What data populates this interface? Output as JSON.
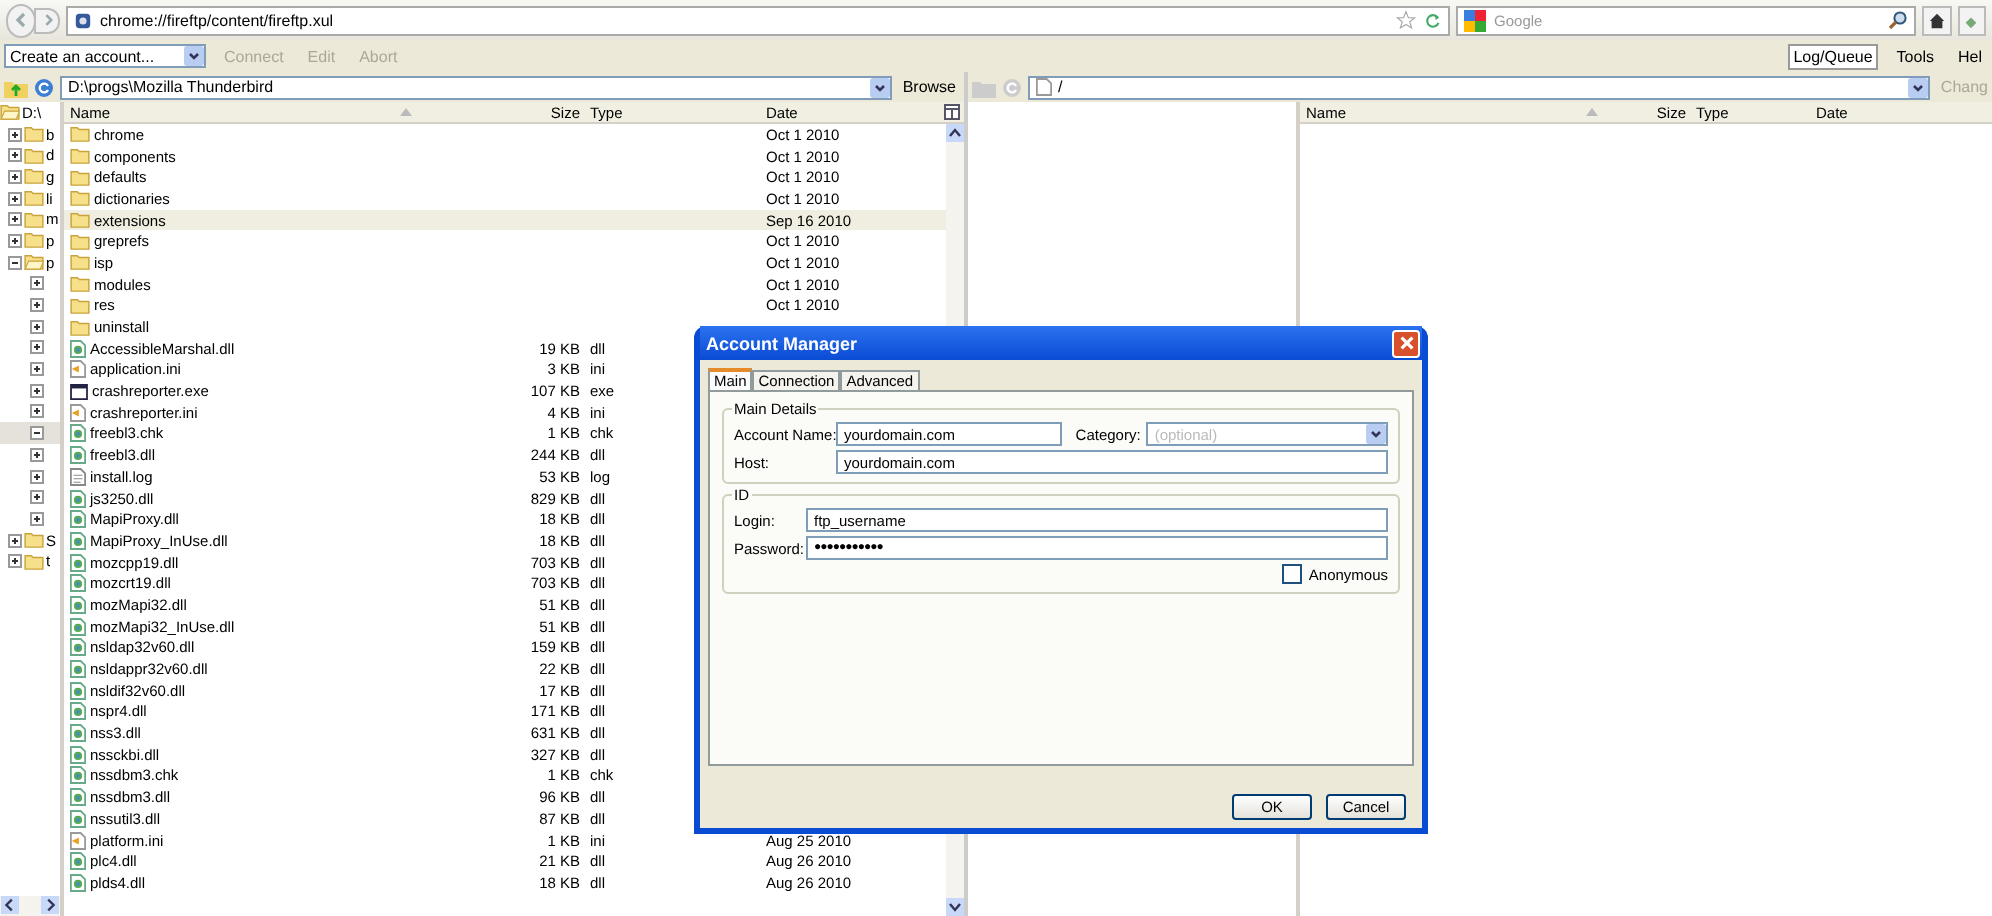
{
  "browser": {
    "address": "chrome://fireftp/content/fireftp.xul",
    "search": {
      "placeholder": "Google"
    }
  },
  "toolbar": {
    "account_select": "Create an account...",
    "actions": [
      {
        "label": "Connect",
        "disabled": true
      },
      {
        "label": "Edit",
        "disabled": true
      },
      {
        "label": "Abort",
        "disabled": true
      }
    ],
    "menu": [
      {
        "label": "Log/Queue",
        "selected": true
      },
      {
        "label": "Tools",
        "selected": false
      },
      {
        "label": "Hel",
        "selected": false
      }
    ]
  },
  "local": {
    "path": "D:\\progs\\Mozilla Thunderbird",
    "browse": "Browse",
    "tree": [
      {
        "label": "D:\\",
        "expanded": true,
        "selected": false,
        "children": [
          {
            "label": "b",
            "expanded": false,
            "selected": false
          },
          {
            "label": "d",
            "expanded": false,
            "selected": false
          },
          {
            "label": "g",
            "expanded": false,
            "selected": false
          },
          {
            "label": "li",
            "expanded": false,
            "selected": false
          },
          {
            "label": "m",
            "expanded": false,
            "selected": false
          },
          {
            "label": "p",
            "expanded": false,
            "selected": false
          },
          {
            "label": "p",
            "expanded": true,
            "selected": false,
            "children": [
              {
                "expanded": false,
                "selected": false
              },
              {
                "expanded": false,
                "selected": false
              },
              {
                "expanded": false,
                "selected": false
              },
              {
                "expanded": false,
                "selected": false
              },
              {
                "expanded": false,
                "selected": false
              },
              {
                "expanded": false,
                "selected": false
              },
              {
                "expanded": false,
                "selected": false
              },
              {
                "expanded": true,
                "selected": true
              },
              {
                "expanded": false,
                "selected": false
              },
              {
                "expanded": false,
                "selected": false
              },
              {
                "expanded": false,
                "selected": false
              },
              {
                "expanded": false,
                "selected": false
              }
            ]
          },
          {
            "label": "S",
            "expanded": false,
            "selected": false
          },
          {
            "label": "t",
            "expanded": false,
            "selected": false
          }
        ]
      }
    ],
    "columns": [
      "Name",
      "Size",
      "Type",
      "Date"
    ],
    "rows": [
      {
        "kind": "folder",
        "name": "chrome",
        "date": "Oct 1 2010",
        "selected": false
      },
      {
        "kind": "folder",
        "name": "components",
        "date": "Oct 1 2010",
        "selected": false
      },
      {
        "kind": "folder",
        "name": "defaults",
        "date": "Oct 1 2010",
        "selected": false
      },
      {
        "kind": "folder",
        "name": "dictionaries",
        "date": "Oct 1 2010",
        "selected": false
      },
      {
        "kind": "folder",
        "name": "extensions",
        "date": "Sep 16 2010",
        "selected": true
      },
      {
        "kind": "folder",
        "name": "greprefs",
        "date": "Oct 1 2010",
        "selected": false
      },
      {
        "kind": "folder",
        "name": "isp",
        "date": "Oct 1 2010",
        "selected": false
      },
      {
        "kind": "folder",
        "name": "modules",
        "date": "Oct 1 2010",
        "selected": false
      },
      {
        "kind": "folder",
        "name": "res",
        "date": "Oct 1 2010",
        "selected": false
      },
      {
        "kind": "folder",
        "name": "uninstall",
        "selected": false
      },
      {
        "kind": "library",
        "name": "AccessibleMarshal.dll",
        "size": "19 KB",
        "type": "dll",
        "selected": false
      },
      {
        "kind": "settings",
        "name": "application.ini",
        "size": "3 KB",
        "type": "ini",
        "selected": false
      },
      {
        "kind": "program",
        "name": "crashreporter.exe",
        "size": "107 KB",
        "type": "exe",
        "selected": false
      },
      {
        "kind": "settings",
        "name": "crashreporter.ini",
        "size": "4 KB",
        "type": "ini",
        "selected": false
      },
      {
        "kind": "library",
        "name": "freebl3.chk",
        "size": "1 KB",
        "type": "chk",
        "selected": false
      },
      {
        "kind": "library",
        "name": "freebl3.dll",
        "size": "244 KB",
        "type": "dll",
        "selected": false
      },
      {
        "kind": "text",
        "name": "install.log",
        "size": "53 KB",
        "type": "log",
        "selected": false
      },
      {
        "kind": "library",
        "name": "js3250.dll",
        "size": "829 KB",
        "type": "dll",
        "selected": false
      },
      {
        "kind": "library",
        "name": "MapiProxy.dll",
        "size": "18 KB",
        "type": "dll",
        "selected": false
      },
      {
        "kind": "library",
        "name": "MapiProxy_InUse.dll",
        "size": "18 KB",
        "type": "dll",
        "selected": false
      },
      {
        "kind": "library",
        "name": "mozcpp19.dll",
        "size": "703 KB",
        "type": "dll",
        "selected": false
      },
      {
        "kind": "library",
        "name": "mozcrt19.dll",
        "size": "703 KB",
        "type": "dll",
        "selected": false
      },
      {
        "kind": "library",
        "name": "mozMapi32.dll",
        "size": "51 KB",
        "type": "dll",
        "selected": false
      },
      {
        "kind": "library",
        "name": "mozMapi32_InUse.dll",
        "size": "51 KB",
        "type": "dll",
        "selected": false
      },
      {
        "kind": "library",
        "name": "nsldap32v60.dll",
        "size": "159 KB",
        "type": "dll",
        "selected": false
      },
      {
        "kind": "library",
        "name": "nsldappr32v60.dll",
        "size": "22 KB",
        "type": "dll",
        "selected": false
      },
      {
        "kind": "library",
        "name": "nsldif32v60.dll",
        "size": "17 KB",
        "type": "dll",
        "selected": false
      },
      {
        "kind": "library",
        "name": "nspr4.dll",
        "size": "171 KB",
        "type": "dll",
        "selected": false
      },
      {
        "kind": "library",
        "name": "nss3.dll",
        "size": "631 KB",
        "type": "dll",
        "selected": false
      },
      {
        "kind": "library",
        "name": "nssckbi.dll",
        "size": "327 KB",
        "type": "dll",
        "selected": false
      },
      {
        "kind": "library",
        "name": "nssdbm3.chk",
        "size": "1 KB",
        "type": "chk",
        "selected": false
      },
      {
        "kind": "library",
        "name": "nssdbm3.dll",
        "size": "96 KB",
        "type": "dll",
        "selected": false
      },
      {
        "kind": "library",
        "name": "nssutil3.dll",
        "size": "87 KB",
        "type": "dll",
        "selected": false
      },
      {
        "kind": "settings",
        "name": "platform.ini",
        "size": "1 KB",
        "type": "ini",
        "date": "Aug 25 2010",
        "selected": false
      },
      {
        "kind": "library",
        "name": "plc4.dll",
        "size": "21 KB",
        "type": "dll",
        "date": "Aug 26 2010",
        "selected": false
      },
      {
        "kind": "library",
        "name": "plds4.dll",
        "size": "18 KB",
        "type": "dll",
        "date": "Aug 26 2010",
        "selected": false
      }
    ]
  },
  "remote": {
    "path": "/",
    "change": "Chang",
    "columns": [
      "Name",
      "Size",
      "Type",
      "Date"
    ]
  },
  "dialog": {
    "title": "Account Manager",
    "tabs": [
      {
        "label": "Main",
        "selected": true
      },
      {
        "label": "Connection",
        "selected": false
      },
      {
        "label": "Advanced",
        "selected": false
      }
    ],
    "main_details": {
      "legend": "Main Details",
      "account_name_label": "Account Name:",
      "account_name": "yourdomain.com",
      "category_label": "Category:",
      "category": {
        "placeholder": "(optional)"
      },
      "host_label": "Host:",
      "host": "yourdomain.com"
    },
    "id": {
      "legend": "ID",
      "login_label": "Login:",
      "login": "ftp_username",
      "password_label": "Password:",
      "password": "●●●●●●●●●●●",
      "anonymous": {
        "label": "Anonymous",
        "checked": false
      }
    },
    "buttons": [
      "OK",
      "Cancel"
    ]
  }
}
